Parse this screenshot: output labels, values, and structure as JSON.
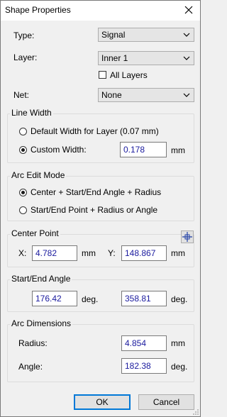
{
  "window": {
    "title": "Shape Properties"
  },
  "type": {
    "label": "Type:",
    "value": "Signal"
  },
  "layer": {
    "label": "Layer:",
    "value": "Inner 1",
    "all_layers_label": "All Layers"
  },
  "net": {
    "label": "Net:",
    "value": "None"
  },
  "line_width": {
    "title": "Line Width",
    "default_option": "Default Width for Layer (0.07 mm)",
    "custom_option": "Custom Width:",
    "custom_value": "0.178",
    "unit": "mm",
    "selected": "custom"
  },
  "arc_edit_mode": {
    "title": "Arc Edit Mode",
    "option_center": "Center + Start/End Angle + Radius",
    "option_endpoints": "Start/End Point + Radius or Angle",
    "selected": "center"
  },
  "center_point": {
    "title": "Center Point",
    "x_label": "X:",
    "x_value": "4.782",
    "x_unit": "mm",
    "y_label": "Y:",
    "y_value": "148.867",
    "y_unit": "mm",
    "pick_icon": "crosshair-icon"
  },
  "angles": {
    "title": "Start/End Angle",
    "start_value": "176.42",
    "start_unit": "deg.",
    "end_value": "358.81",
    "end_unit": "deg."
  },
  "arc_dimensions": {
    "title": "Arc Dimensions",
    "radius_label": "Radius:",
    "radius_value": "4.854",
    "radius_unit": "mm",
    "angle_label": "Angle:",
    "angle_value": "182.38",
    "angle_unit": "deg."
  },
  "buttons": {
    "ok": "OK",
    "cancel": "Cancel"
  },
  "colors": {
    "accent": "#0078d7",
    "field_text": "#1a1a9e",
    "pick_icon": "#1f3fa6"
  }
}
